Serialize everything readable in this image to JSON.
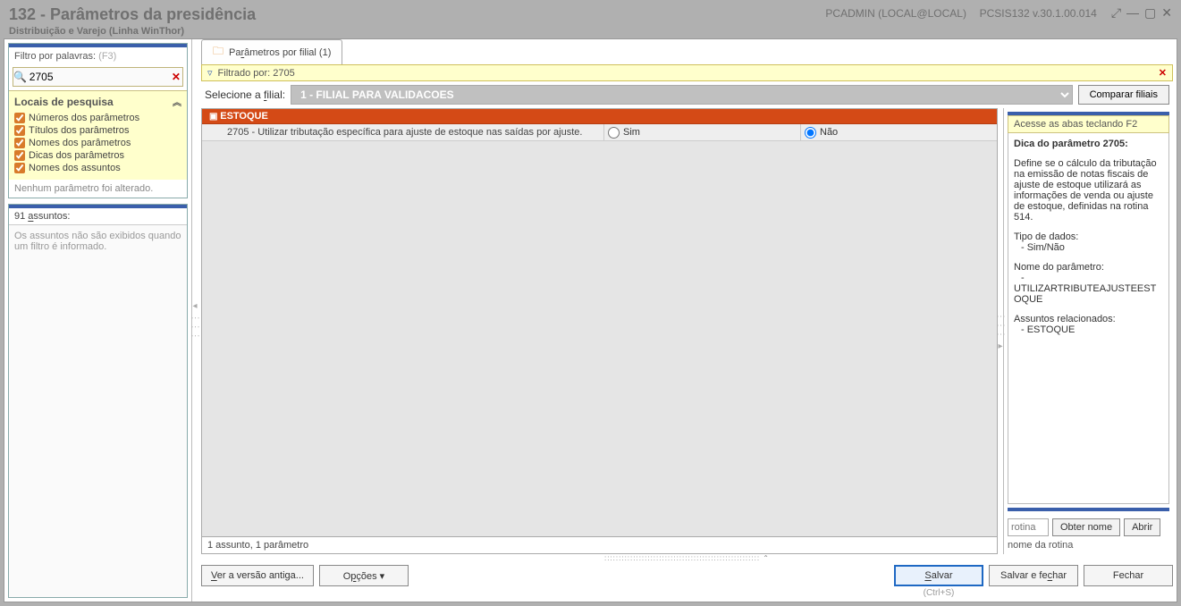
{
  "window": {
    "title": "132 - Parâmetros da presidência",
    "subtitle": "Distribuição e Varejo (Linha WinThor)",
    "user_info": "PCADMIN (LOCAL@LOCAL)",
    "build_info": "PCSIS132  v.30.1.00.014"
  },
  "left": {
    "filter_label_pre": "Filtro por palavras: ",
    "filter_label_hint": "(F3)",
    "filter_value": "2705",
    "locais_title": "Locais de pesquisa",
    "checks": [
      "Números dos parâmetros",
      "Títulos dos parâmetros",
      "Nomes dos parâmetros",
      "Dicas dos parâmetros",
      "Nomes dos assuntos"
    ],
    "status": "Nenhum parâmetro foi alterado.",
    "assuntos_title": "91 assuntos:",
    "assuntos_body": "Os assuntos não são exibidos quando um filtro é informado."
  },
  "center": {
    "tab_label": "Parâmetros por filial  (1)",
    "filtered_by": "Filtrado por: 2705",
    "filial_label": "Selecione a filial:",
    "filial_value": "1 - FILIAL PARA VALIDACOES",
    "compare_btn": "Comparar filiais",
    "group_header": "ESTOQUE",
    "row_desc": "2705 - Utilizar tributação específica para ajuste de estoque nas saídas por ajuste.",
    "opt_sim": "Sim",
    "opt_nao": "Não",
    "grid_status": "1 assunto, 1 parâmetro",
    "btn_ver_antiga": "Ver a versão antiga...",
    "btn_opcoes": "Opções ▾",
    "btn_salvar": "Salvar",
    "btn_salvar_hint": "(Ctrl+S)",
    "btn_salvar_fechar": "Salvar e fechar",
    "btn_fechar": "Fechar"
  },
  "right": {
    "hint_bar": "Acesse as abas teclando F2",
    "tip_title": "Dica do parâmetro 2705:",
    "tip_body": "Define se o cálculo da tributação na emissão de notas fiscais de ajuste de estoque utilizará as informações de venda ou ajuste de estoque, definidas na rotina 514.",
    "tipo_label": "Tipo de dados:",
    "tipo_value": "- Sim/Não",
    "nome_label": "Nome do parâmetro:",
    "nome_value": "UTILIZARTRIBUTEAJUSTEESTOQUE",
    "rel_label": "Assuntos relacionados:",
    "rel_value": "- ESTOQUE",
    "rotina_placeholder": "rotina",
    "btn_obter": "Obter nome",
    "btn_abrir": "Abrir",
    "rotina_name": "nome da rotina"
  }
}
